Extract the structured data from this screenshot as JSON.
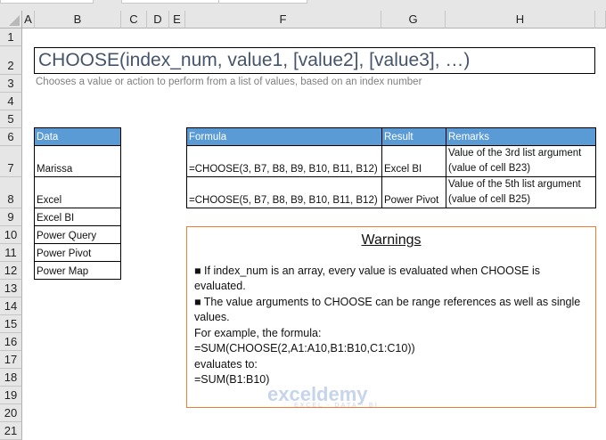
{
  "columns": [
    "A",
    "B",
    "C",
    "D",
    "E",
    "F",
    "G",
    "H"
  ],
  "rows": [
    "1",
    "2",
    "3",
    "4",
    "5",
    "6",
    "7",
    "8",
    "9",
    "10",
    "11",
    "12",
    "13",
    "14",
    "15",
    "16",
    "17",
    "18",
    "19",
    "20",
    "21"
  ],
  "title": "CHOOSE(index_num, value1, [value2], [value3], …)",
  "subtitle": "Chooses a value or action to perform from a list of values, based on an index number",
  "data_table": {
    "header": "Data",
    "items": [
      "Marissa",
      "Excel",
      "Excel BI",
      "Power Query",
      "Power Pivot",
      "Power Map"
    ]
  },
  "formula_table": {
    "headers": [
      "Formula",
      "Result",
      "Remarks"
    ],
    "rows": [
      {
        "formula": "=CHOOSE(3, B7, B8, B9, B10, B11, B12)",
        "result": "Excel BI",
        "remark1": "Value of the 3rd list argument",
        "remark2": "(value of cell B23)"
      },
      {
        "formula": "=CHOOSE(5, B7, B8, B9, B10, B11, B12)",
        "result": "Power Pivot",
        "remark1": "Value of the 5th list argument",
        "remark2": "(value of cell B25)"
      }
    ]
  },
  "warnings": {
    "title": "Warnings",
    "lines": [
      "■ If index_num is an array, every value is evaluated when CHOOSE is evaluated.",
      "■ The value arguments to CHOOSE can be range references as well as single values.",
      "For example, the formula:",
      "=SUM(CHOOSE(2,A1:A10,B1:B10,C1:C10))",
      "evaluates to:",
      "=SUM(B1:B10)"
    ]
  },
  "watermark": {
    "name": "exceldemy",
    "tagline": "EXCEL · DATA · BI"
  }
}
